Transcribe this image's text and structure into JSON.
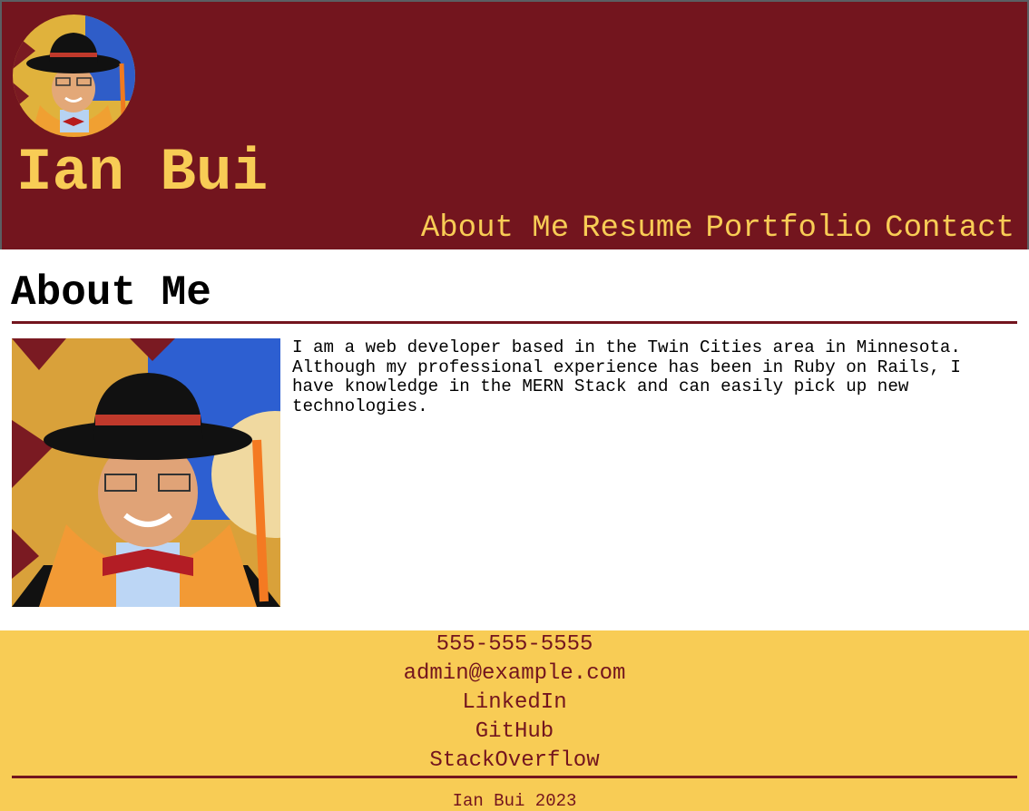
{
  "header": {
    "site_title": "Ian Bui",
    "avatar_alt": "Ian Bui graduation portrait",
    "nav": [
      "About Me",
      "Resume",
      "Portfolio",
      "Contact"
    ]
  },
  "about": {
    "heading": "About Me",
    "photo_alt": "Ian Bui in cowboy hat and graduation stole",
    "bio": "I am a web developer based in the Twin Cities area in Minnesota. Although my professional experience has been in Ruby on Rails, I have knowledge in the MERN Stack and can easily pick up new technologies."
  },
  "footer": {
    "phone": "555-555-5555",
    "email": "admin@example.com",
    "linkedin": "LinkedIn",
    "github": "GitHub",
    "stackoverflow": "StackOverflow",
    "copyright": "Ian Bui 2023"
  },
  "colors": {
    "maroon": "#73151e",
    "gold": "#f8cc55"
  }
}
